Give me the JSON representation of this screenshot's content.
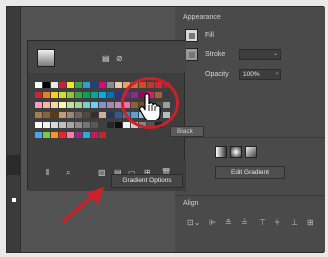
{
  "appearance": {
    "title": "Appearance",
    "fill_label": "Fill",
    "stroke_label": "Stroke",
    "opacity_label": "Opacity",
    "opacity_value": "100%"
  },
  "gradient": {
    "edit_button": "Edit Gradient",
    "options_button": "Gradient Options"
  },
  "align": {
    "title": "Align"
  },
  "tooltip": "Black",
  "colors": {
    "highlight": "#c9222a",
    "panel": "#3e3e3e"
  },
  "icons": [
    "fill-swatch-icon",
    "list-view-icon",
    "grid-view-icon",
    "new-swatch-icon",
    "delete-icon",
    "align-left-icon",
    "pointer-hand-icon",
    "arrow-icon"
  ]
}
